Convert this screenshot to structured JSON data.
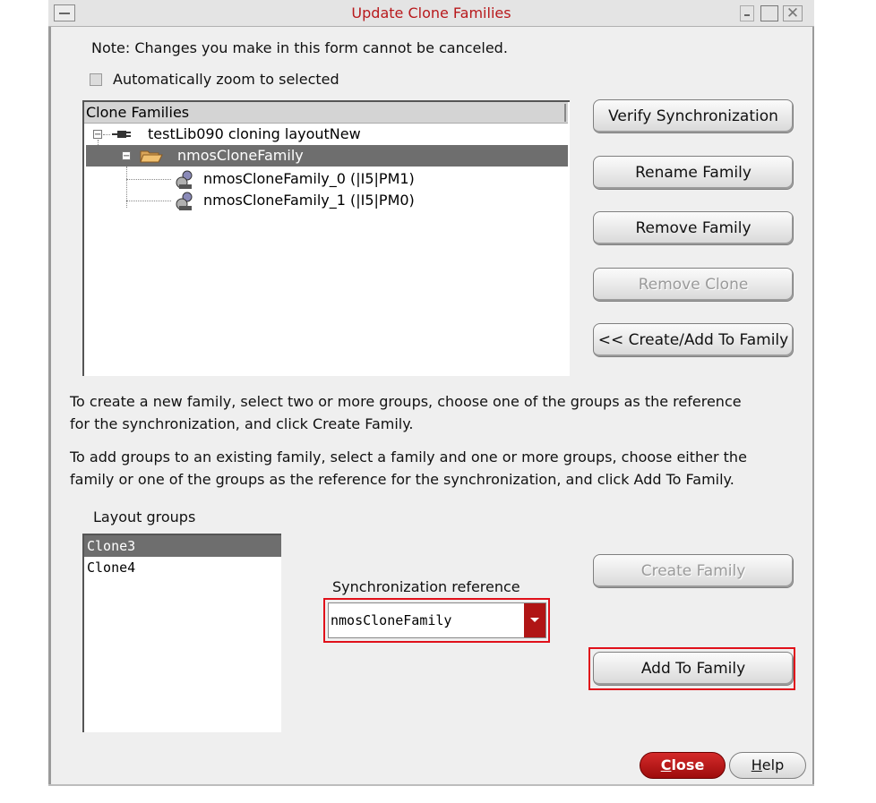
{
  "window": {
    "title": "Update Clone Families"
  },
  "note": "Note: Changes you make in this form cannot be canceled.",
  "auto_zoom": {
    "label": "Automatically zoom to selected",
    "checked": false
  },
  "tree": {
    "header": "Clone Families",
    "nodes": [
      {
        "label": "testLib090 cloning layoutNew",
        "icon": "plug-icon",
        "expander": "minus",
        "selected": false
      },
      {
        "label": "nmosCloneFamily",
        "icon": "folder-open-icon",
        "expander": "minus",
        "selected": true
      },
      {
        "label": "nmosCloneFamily_0 (|I5|PM1)",
        "icon": "clone-icon",
        "selected": false
      },
      {
        "label": "nmosCloneFamily_1 (|I5|PM0)",
        "icon": "clone-icon",
        "selected": false
      }
    ]
  },
  "buttons": {
    "verify": "Verify Synchronization",
    "rename": "Rename Family",
    "remove_family": "Remove Family",
    "remove_clone": "Remove Clone",
    "create_add": "<< Create/Add To Family",
    "create_family": "Create Family",
    "add_to_family": "Add To Family",
    "close": "Close",
    "close_mnemonic": "C",
    "close_rest": "lose",
    "help": "Help",
    "help_mnemonic": "H",
    "help_rest": "elp"
  },
  "instructions": {
    "create_line1": "To create a new family, select two or more groups, choose one of the groups as the reference",
    "create_line2": "for the synchronization, and click Create Family.",
    "add_line1": "To add groups to an existing family, select a family and one or more groups, choose either the",
    "add_line2": "family or one of the groups as the reference for the synchronization, and click Add To Family."
  },
  "layout_groups": {
    "label": "Layout groups",
    "items": [
      {
        "label": "Clone3",
        "selected": true
      },
      {
        "label": "Clone4",
        "selected": false
      }
    ]
  },
  "sync_reference": {
    "label": "Synchronization reference",
    "value": "nmosCloneFamily"
  },
  "colors": {
    "title_red": "#b8191c",
    "highlight_red": "#e0101a",
    "selection_gray": "#6e6e6e",
    "close_red": "#b01515"
  }
}
